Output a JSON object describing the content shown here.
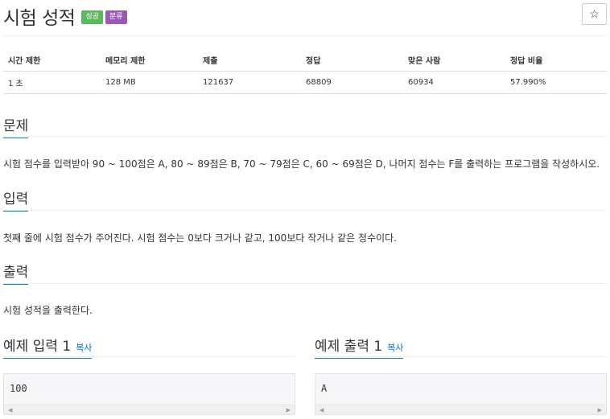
{
  "problem": {
    "title": "시험 성적",
    "badges": [
      "성공",
      "분류"
    ],
    "star_icon": "☆"
  },
  "info_table": {
    "headers": [
      "시간 제한",
      "메모리 제한",
      "제출",
      "정답",
      "맞은 사람",
      "정답 비율"
    ],
    "values": [
      "1 초",
      "128 MB",
      "121637",
      "68809",
      "60934",
      "57.990%"
    ]
  },
  "sections": {
    "description": {
      "heading": "문제",
      "text": "시험 점수를 입력받아 90 ~ 100점은 A, 80 ~ 89점은 B, 70 ~ 79점은 C, 60 ~ 69점은 D, 나머지 점수는 F를 출력하는 프로그램을 작성하시오."
    },
    "input": {
      "heading": "입력",
      "text": "첫째 줄에 시험 점수가 주어진다. 시험 점수는 0보다 크거나 같고, 100보다 작거나 같은 정수이다."
    },
    "output": {
      "heading": "출력",
      "text": "시험 성적을 출력한다."
    }
  },
  "samples": {
    "input": {
      "heading": "예제 입력 1",
      "copy_label": "복사",
      "content": "100"
    },
    "output": {
      "heading": "예제 출력 1",
      "copy_label": "복사",
      "content": "A"
    }
  },
  "colors": {
    "badge_success": "#5cb85c",
    "badge_category": "#9b59b6",
    "accent": "#0076c0"
  }
}
